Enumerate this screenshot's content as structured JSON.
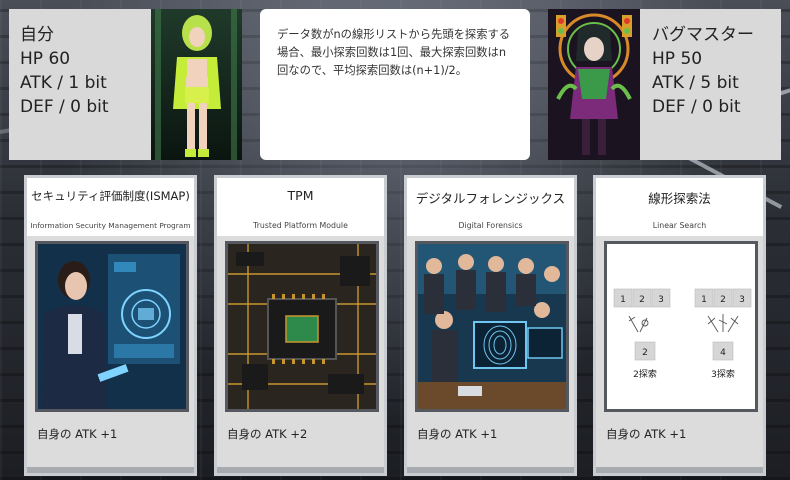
{
  "player": {
    "name": "自分",
    "hp": "HP 60",
    "atk": "ATK / 1 bit",
    "def": "DEF / 0 bit"
  },
  "message": {
    "text": "データ数がnの線形リストから先頭を探索する場合、最小探索回数は1回、最大探索回数はn回なので、平均探索回数は(n+1)/2。"
  },
  "enemy": {
    "name": "バグマスター",
    "hp": "HP 50",
    "atk": "ATK / 5 bit",
    "def": "DEF / 0 bit"
  },
  "cards": [
    {
      "title": "セキュリティ評価制度(ISMAP)",
      "subtitle": "Information Security Management Program",
      "effect": "自身の ATK +1",
      "art_icon": "security-officer-hologram"
    },
    {
      "title": "TPM",
      "subtitle": "Trusted Platform Module",
      "effect": "自身の ATK +2",
      "art_icon": "circuit-chip"
    },
    {
      "title": "デジタルフォレンジックス",
      "subtitle": "Digital Forensics",
      "effect": "自身の ATK +1",
      "art_icon": "forensics-team-fingerprint"
    },
    {
      "title": "線形探索法",
      "subtitle": "Linear Search",
      "effect": "自身の ATK +1",
      "art_icon": "linear-search-diagram"
    }
  ],
  "diagram": {
    "left_cells": [
      "1",
      "2",
      "3"
    ],
    "left_target": "2",
    "left_caption": "2探索",
    "right_cells": [
      "1",
      "2",
      "3"
    ],
    "right_target": "4",
    "right_caption": "3探索"
  }
}
